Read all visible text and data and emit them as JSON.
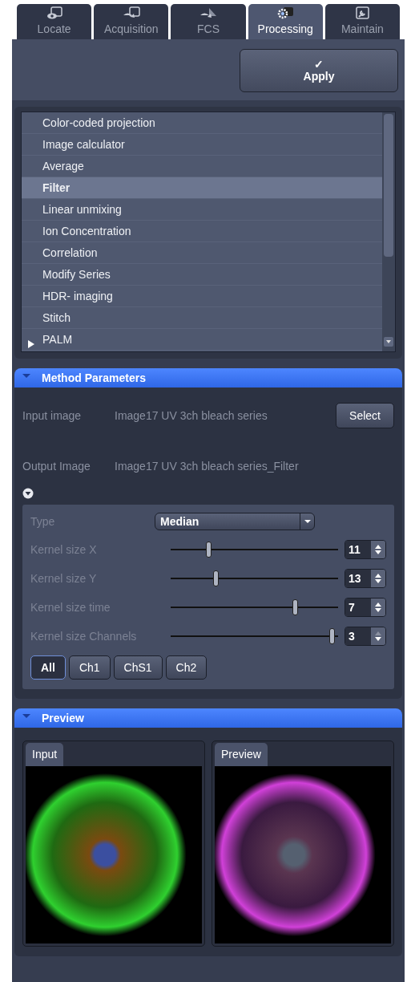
{
  "tabs": [
    {
      "label": "Locate",
      "selected": false
    },
    {
      "label": "Acquisition",
      "selected": false
    },
    {
      "label": "FCS",
      "selected": false
    },
    {
      "label": "Processing",
      "selected": true
    },
    {
      "label": "Maintain",
      "selected": false
    }
  ],
  "apply_button": {
    "icon": "✓",
    "label": "Apply"
  },
  "methods": [
    {
      "label": "Color-coded projection",
      "selected": false,
      "expandable": false
    },
    {
      "label": "Image calculator",
      "selected": false,
      "expandable": false
    },
    {
      "label": "Average",
      "selected": false,
      "expandable": false
    },
    {
      "label": "Filter",
      "selected": true,
      "expandable": false
    },
    {
      "label": "Linear unmixing",
      "selected": false,
      "expandable": false
    },
    {
      "label": "Ion Concentration",
      "selected": false,
      "expandable": false
    },
    {
      "label": "Correlation",
      "selected": false,
      "expandable": false
    },
    {
      "label": "Modify Series",
      "selected": false,
      "expandable": false
    },
    {
      "label": "HDR- imaging",
      "selected": false,
      "expandable": false
    },
    {
      "label": "Stitch",
      "selected": false,
      "expandable": false
    },
    {
      "label": "PALM",
      "selected": false,
      "expandable": true
    }
  ],
  "method_parameters": {
    "title": "Method Parameters",
    "expanded": true,
    "input_label": "Input image",
    "input_value": "Image17 UV 3ch bleach series",
    "select_button": "Select",
    "output_label": "Output Image",
    "output_value": "Image17 UV 3ch bleach series_Filter",
    "options_expanded": true,
    "type_label": "Type",
    "type_value": "Median",
    "sliders": [
      {
        "label": "Kernel size X",
        "level": 0.22,
        "value": "11",
        "up_enabled": true
      },
      {
        "label": "Kernel size Y",
        "level": 0.26,
        "value": "13",
        "up_enabled": true
      },
      {
        "label": "Kernel size time",
        "level": 0.75,
        "value": "7",
        "up_enabled": true
      },
      {
        "label": "Kernel size Channels",
        "level": 0.98,
        "value": "3",
        "up_enabled": false
      }
    ],
    "channels": [
      {
        "label": "All",
        "selected": true
      },
      {
        "label": "Ch1",
        "selected": false
      },
      {
        "label": "ChS1",
        "selected": false
      },
      {
        "label": "Ch2",
        "selected": false
      }
    ]
  },
  "preview": {
    "title": "Preview",
    "expanded": true,
    "panes": [
      {
        "tab": "Input",
        "kind": "input"
      },
      {
        "tab": "Preview",
        "kind": "filtered"
      }
    ]
  }
}
